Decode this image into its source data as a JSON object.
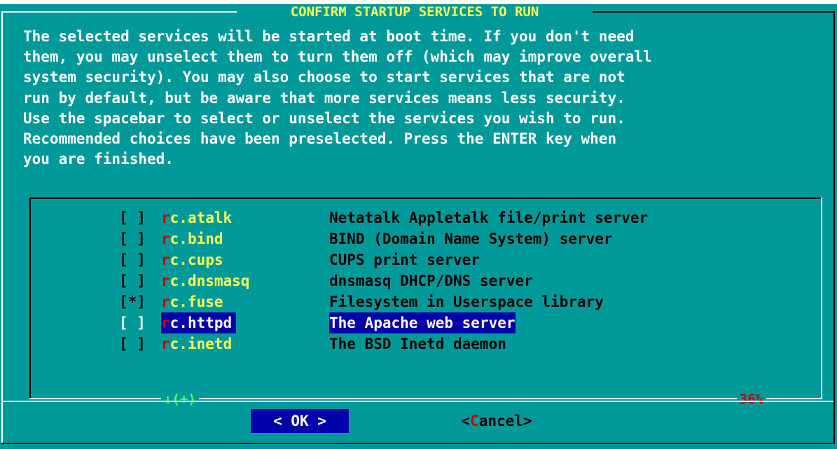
{
  "dialog": {
    "title": "CONFIRM STARTUP SERVICES TO RUN",
    "description": "The selected services will be started at boot time.  If you don't need\nthem, you may unselect them to turn them off (which may improve overall\nsystem security).  You may also choose to start services that are not\nrun by default, but be aware that more services means less security.\nUse the spacebar to select or unselect the services you wish to run.\nRecommended choices have been preselected.  Press the ENTER key when\nyou are finished."
  },
  "list": {
    "items": [
      {
        "checkbox": "[ ]",
        "hotkey": "r",
        "name_rest": "c.atalk",
        "description": "Netatalk Appletalk file/print server",
        "checked": false,
        "selected": false
      },
      {
        "checkbox": "[ ]",
        "hotkey": "r",
        "name_rest": "c.bind",
        "description": "BIND (Domain Name System) server",
        "checked": false,
        "selected": false
      },
      {
        "checkbox": "[ ]",
        "hotkey": "r",
        "name_rest": "c.cups",
        "description": "CUPS print server",
        "checked": false,
        "selected": false
      },
      {
        "checkbox": "[ ]",
        "hotkey": "r",
        "name_rest": "c.dnsmasq",
        "description": "dnsmasq DHCP/DNS server",
        "checked": false,
        "selected": false
      },
      {
        "checkbox": "[*]",
        "hotkey": "r",
        "name_rest": "c.fuse",
        "description": "Filesystem in Userspace library",
        "checked": true,
        "selected": false
      },
      {
        "checkbox": "[ ]",
        "hotkey": "r",
        "name_rest": "c.httpd",
        "description": "The Apache web server",
        "checked": false,
        "selected": true
      },
      {
        "checkbox": "[ ]",
        "hotkey": "r",
        "name_rest": "c.inetd",
        "description": "The BSD Inetd daemon",
        "checked": false,
        "selected": false
      }
    ],
    "scroll_indicator": "↓(+)",
    "scroll_percent": "36%"
  },
  "buttons": {
    "ok_label": "<  OK  >",
    "cancel_open": "<",
    "cancel_hotkey": "C",
    "cancel_rest": "ancel>"
  },
  "colors": {
    "background": "#009999",
    "highlight": "#0000aa",
    "title": "#ffff55",
    "hotkey": "#cc0000",
    "service_name": "#ffff55"
  }
}
